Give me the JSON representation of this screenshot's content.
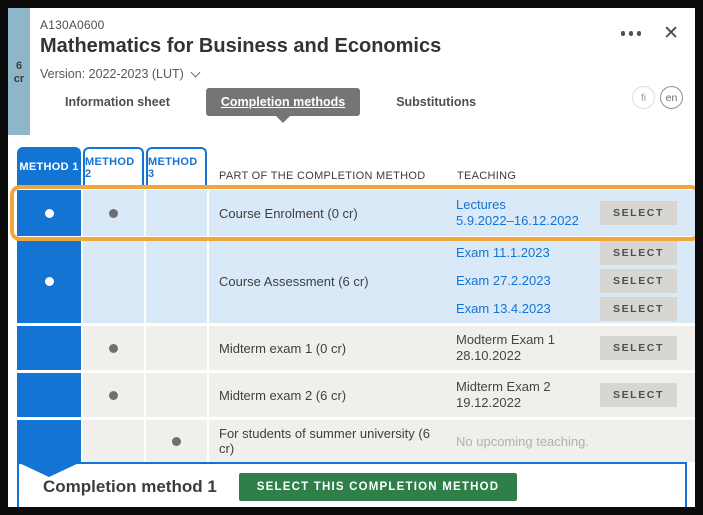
{
  "window": {
    "credits_value": "6",
    "credits_unit": "cr",
    "course_code": "A130A0600",
    "course_title": "Mathematics for Business and Economics",
    "version_label": "Version: 2022-2023 (LUT)"
  },
  "tabs": {
    "information_sheet": "Information sheet",
    "completion_methods": "Completion methods",
    "substitutions": "Substitutions"
  },
  "language_buttons": {
    "fi": "fi",
    "en": "en"
  },
  "table": {
    "method_tabs": {
      "m1": "METHOD 1",
      "m2": "METHOD 2",
      "m3": "METHOD 3"
    },
    "column_headers": {
      "part": "PART OF THE COMPLETION METHOD",
      "teaching": "TEACHING"
    },
    "select_label": "SELECT",
    "rows": [
      {
        "part": "Course Enrolment (0 cr)",
        "included_methods": [
          "METHOD 1",
          "METHOD 2"
        ],
        "highlighted": true,
        "teaching": [
          {
            "title": "Lectures",
            "date": "5.9.2022–16.12.2022",
            "is_link": true
          }
        ]
      },
      {
        "part": "Course Assessment (6 cr)",
        "included_methods": [
          "METHOD 1"
        ],
        "teaching": [
          {
            "title": "Exam 11.1.2023",
            "is_link": true
          },
          {
            "title": "Exam 27.2.2023",
            "is_link": true
          },
          {
            "title": "Exam 13.4.2023",
            "is_link": true
          }
        ]
      },
      {
        "part": "Midterm exam 1 (0 cr)",
        "included_methods": [
          "METHOD 2"
        ],
        "teaching": [
          {
            "title": "Modterm Exam 1",
            "date": "28.10.2022",
            "is_link": false
          }
        ]
      },
      {
        "part": "Midterm exam 2 (6 cr)",
        "included_methods": [
          "METHOD 2"
        ],
        "teaching": [
          {
            "title": "Midterm Exam 2",
            "date": "19.12.2022",
            "is_link": false
          }
        ]
      },
      {
        "part": "For students of summer university (6 cr)",
        "included_methods": [
          "METHOD 3"
        ],
        "empty_note": "No upcoming teaching."
      }
    ]
  },
  "footer": {
    "heading": "Completion method 1",
    "select_button": "SELECT THIS COMPLETION METHOD"
  },
  "colors": {
    "accent_blue": "#1374d4",
    "row_highlight_blue": "#d9e9f8",
    "row_gray": "#f0efec",
    "highlight_orange": "#efa63d",
    "select_button_bg": "#d8d6d3",
    "confirm_green": "#2e7f48",
    "selected_tab_bg": "#757575",
    "credits_strip": "#8fb5c9"
  }
}
